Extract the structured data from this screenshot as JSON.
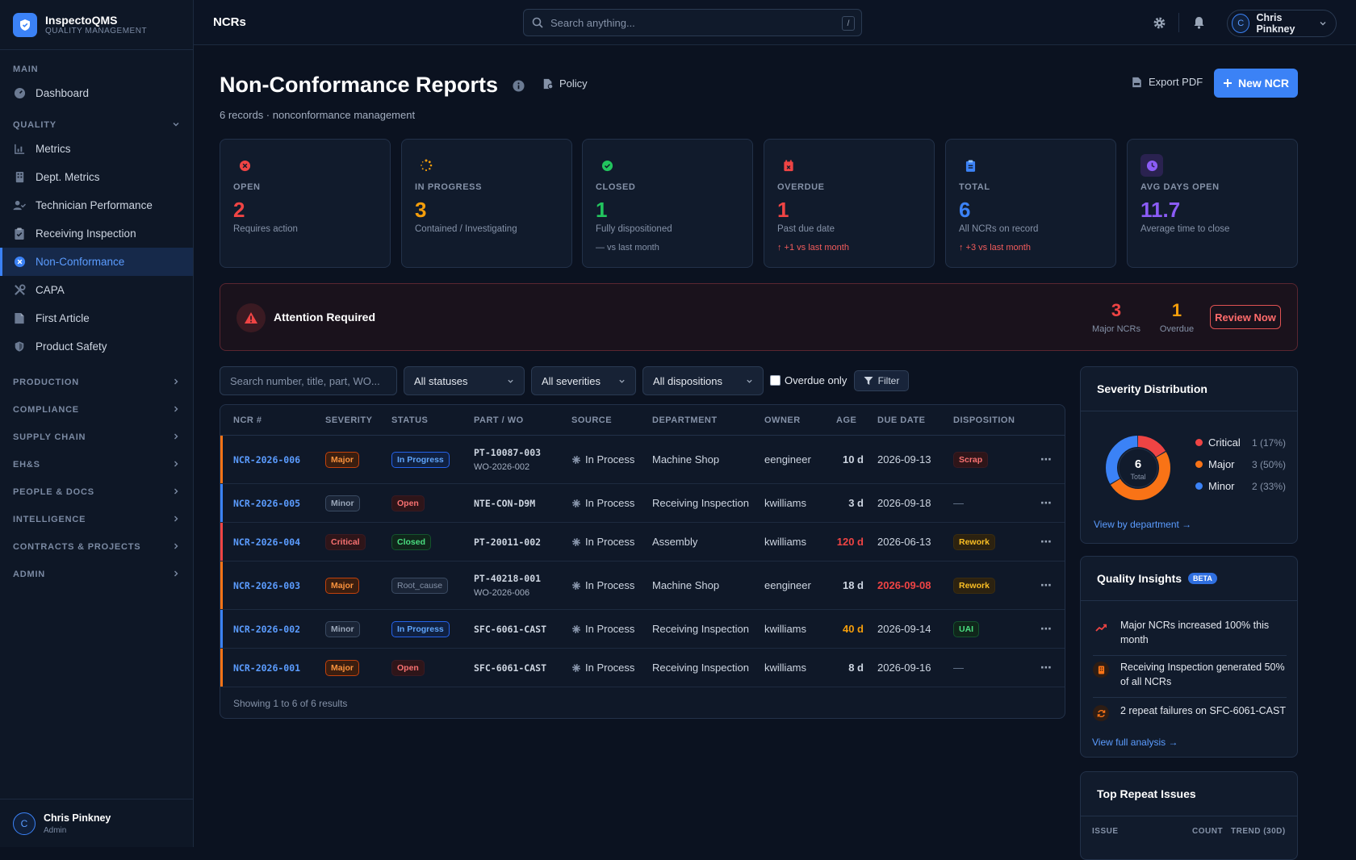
{
  "brand": {
    "name": "InspectoQMS",
    "subtitle": "QUALITY MANAGEMENT"
  },
  "sidebar": {
    "main_label": "MAIN",
    "dashboard": "Dashboard",
    "quality_label": "QUALITY",
    "items": [
      "Metrics",
      "Dept. Metrics",
      "Technician Performance",
      "Receiving Inspection",
      "Non-Conformance",
      "CAPA",
      "First Article",
      "Product Safety"
    ],
    "collapsed": [
      "PRODUCTION",
      "COMPLIANCE",
      "SUPPLY CHAIN",
      "EH&S",
      "PEOPLE & DOCS",
      "INTELLIGENCE",
      "CONTRACTS & PROJECTS",
      "ADMIN"
    ],
    "user": {
      "initial": "C",
      "name": "Chris Pinkney",
      "role": "Admin"
    }
  },
  "topbar": {
    "title": "NCRs",
    "search_placeholder": "Search anything...",
    "kbd": "/",
    "user_initial": "C",
    "user_name": "Chris Pinkney"
  },
  "header": {
    "title": "Non-Conformance Reports",
    "subtitle": "6 records · nonconformance management",
    "policy": "Policy",
    "export": "Export PDF",
    "new": "New NCR"
  },
  "stats": [
    {
      "label": "OPEN",
      "value": "2",
      "desc": "Requires action",
      "trend": "",
      "color": "#ef4444"
    },
    {
      "label": "IN PROGRESS",
      "value": "3",
      "desc": "Contained / Investigating",
      "trend": "",
      "color": "#f59e0b"
    },
    {
      "label": "CLOSED",
      "value": "1",
      "desc": "Fully dispositioned",
      "trend": "— vs last month",
      "color": "#22c55e"
    },
    {
      "label": "OVERDUE",
      "value": "1",
      "desc": "Past due date",
      "trend": "↑ +1 vs last month",
      "color": "#ef4444"
    },
    {
      "label": "TOTAL",
      "value": "6",
      "desc": "All NCRs on record",
      "trend": "↑ +3 vs last month",
      "color": "#3b82f6"
    },
    {
      "label": "AVG DAYS OPEN",
      "value": "11.7",
      "desc": "Average time to close",
      "trend": "",
      "color": "#8b5cf6"
    }
  ],
  "attention": {
    "title": "Attention Required",
    "major_value": "3",
    "major_label": "Major NCRs",
    "overdue_value": "1",
    "overdue_label": "Overdue",
    "button": "Review Now"
  },
  "filters": {
    "search_placeholder": "Search number, title, part, WO...",
    "status": "All statuses",
    "severity": "All severities",
    "disposition": "All dispositions",
    "overdue_label": "Overdue only",
    "filter_button": "Filter"
  },
  "table": {
    "headers": [
      "NCR #",
      "SEVERITY",
      "STATUS",
      "PART / WO",
      "SOURCE",
      "DEPARTMENT",
      "OWNER",
      "AGE",
      "DUE DATE",
      "DISPOSITION"
    ],
    "rows": [
      {
        "ncr": "NCR-2026-006",
        "severity": "Major",
        "status": "In Progress",
        "part": "PT-10087-003",
        "wo": "WO-2026-002",
        "source": "In Process",
        "dept": "Machine Shop",
        "owner": "eengineer",
        "age": "10 d",
        "due": "2026-09-13",
        "disp": "Scrap"
      },
      {
        "ncr": "NCR-2026-005",
        "severity": "Minor",
        "status": "Open",
        "part": "NTE-CON-D9M",
        "wo": "",
        "source": "In Process",
        "dept": "Receiving Inspection",
        "owner": "kwilliams",
        "age": "3 d",
        "due": "2026-09-18",
        "disp": "—"
      },
      {
        "ncr": "NCR-2026-004",
        "severity": "Critical",
        "status": "Closed",
        "part": "PT-20011-002",
        "wo": "",
        "source": "In Process",
        "dept": "Assembly",
        "owner": "kwilliams",
        "age": "120 d",
        "due": "2026-06-13",
        "disp": "Rework"
      },
      {
        "ncr": "NCR-2026-003",
        "severity": "Major",
        "status": "Root_cause",
        "part": "PT-40218-001",
        "wo": "WO-2026-006",
        "source": "In Process",
        "dept": "Machine Shop",
        "owner": "eengineer",
        "age": "18 d",
        "due": "2026-09-08",
        "disp": "Rework"
      },
      {
        "ncr": "NCR-2026-002",
        "severity": "Minor",
        "status": "In Progress",
        "part": "SFC-6061-CAST",
        "wo": "",
        "source": "In Process",
        "dept": "Receiving Inspection",
        "owner": "kwilliams",
        "age": "40 d",
        "due": "2026-09-14",
        "disp": "UAI"
      },
      {
        "ncr": "NCR-2026-001",
        "severity": "Major",
        "status": "Open",
        "part": "SFC-6061-CAST",
        "wo": "",
        "source": "In Process",
        "dept": "Receiving Inspection",
        "owner": "kwilliams",
        "age": "8 d",
        "due": "2026-09-16",
        "disp": "—"
      }
    ],
    "footer": "Showing 1 to 6 of 6 results"
  },
  "severity_panel": {
    "title": "Severity Distribution",
    "total_value": "6",
    "total_label": "Total",
    "legend": [
      {
        "name": "Critical",
        "value": "1 (17%)",
        "color": "#ef4444"
      },
      {
        "name": "Major",
        "value": "3 (50%)",
        "color": "#f97316"
      },
      {
        "name": "Minor",
        "value": "2 (33%)",
        "color": "#3b82f6"
      }
    ],
    "link": "View by department →"
  },
  "chart_data": {
    "type": "pie",
    "categories": [
      "Critical",
      "Major",
      "Minor"
    ],
    "values": [
      1,
      3,
      2
    ],
    "title": "Severity Distribution"
  },
  "insights_panel": {
    "title": "Quality Insights",
    "badge": "BETA",
    "items": [
      "Major NCRs increased 100% this month",
      "Receiving Inspection generated 50% of all NCRs",
      "2 repeat failures on SFC-6061-CAST"
    ],
    "link": "View full analysis →"
  },
  "repeat_panel": {
    "title": "Top Repeat Issues",
    "headers": [
      "ISSUE",
      "COUNT",
      "TREND (30D)"
    ]
  }
}
